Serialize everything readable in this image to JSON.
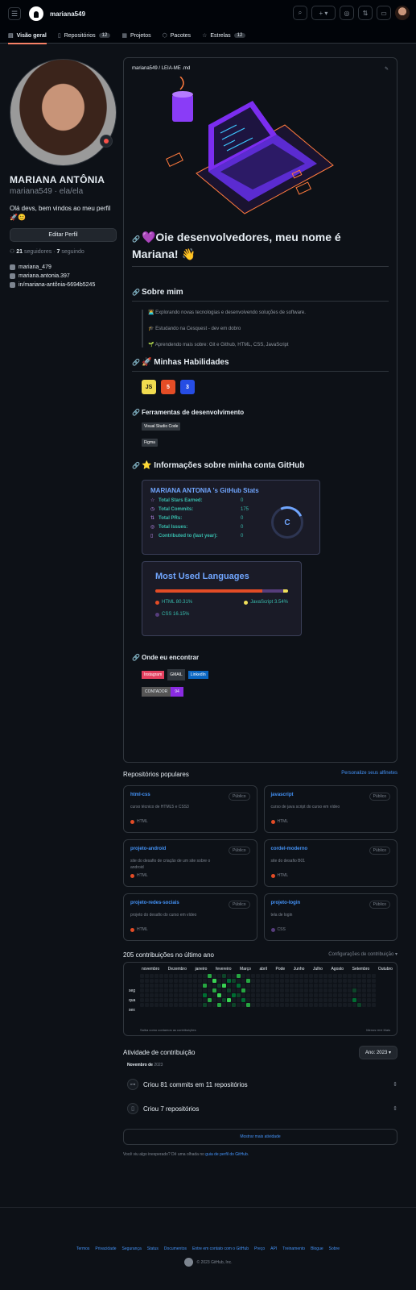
{
  "header": {
    "username": "mariana549",
    "menu_icon": "menu-icon",
    "plus_label": "+",
    "avatar_alt": "avatar"
  },
  "tabs": [
    {
      "label": "Visão geral",
      "active": true
    },
    {
      "label": "Repositórios",
      "count": "12"
    },
    {
      "label": "Projetos"
    },
    {
      "label": "Pacotes"
    },
    {
      "label": "Estrelas",
      "count": "12"
    }
  ],
  "profile": {
    "name": "MARIANA ANTÔNIA",
    "login": "mariana549",
    "pronouns": "· ela/ela",
    "bio": "Olá devs, bem vindos ao meu perfil 🚀😊",
    "edit_label": "Editar Perfil",
    "followers": "21",
    "followers_label": "seguidores",
    "following": "7",
    "following_label": "seguindo",
    "links": [
      "mariana_479",
      "mariana.antonia.397",
      "in/mariana-antônia-6694b5245"
    ]
  },
  "readme": {
    "path": "mariana549 / LEIA-ME .md",
    "title": "💜Oie desenvolvedores, meu nome é Mariana! 👋",
    "about_title": "Sobre mim",
    "about": [
      "👩‍💻 Explorando novas tecnologias e desenvolvendo soluções de software.",
      "🎓 Estudando na Cesquest - dev em dobro",
      "🌱 Aprendendo mais sobre: Git e Github, HTML, CSS, JavaScript"
    ],
    "skills_title": "🚀 Minhas Habilidades",
    "skills": [
      "JS",
      "5",
      "3"
    ],
    "tools_title": "Ferramentas de desenvolvimento",
    "tools": [
      "Visual Studio Code",
      "Figma"
    ],
    "stats_title": "⭐ Informações sobre minha conta GitHub",
    "stats_card": {
      "title": "MARIANA ANTONIA 's GitHub Stats",
      "rows": [
        {
          "label": "Total Stars Earned:",
          "value": "0"
        },
        {
          "label": "Total Commits:",
          "value": "175"
        },
        {
          "label": "Total PRs:",
          "value": "0"
        },
        {
          "label": "Total Issues:",
          "value": "0"
        },
        {
          "label": "Contributed to (last year):",
          "value": "0"
        }
      ],
      "grade": "C"
    },
    "langs_card": {
      "title": "Most Used Languages",
      "items": [
        {
          "name": "HTML 80.31%",
          "pct": 80.31,
          "color": "#e34c26"
        },
        {
          "name": "JavaScript 3.54%",
          "pct": 3.54,
          "color": "#f1e05a"
        },
        {
          "name": "CSS 16.15%",
          "pct": 16.15,
          "color": "#563d7c"
        }
      ]
    },
    "find_title": "Onde eu encontrar",
    "socials": [
      "Instagram",
      "GMAIL",
      "LinkedIn"
    ],
    "counter_label": "CONTADOR",
    "counter_value": "94"
  },
  "popular": {
    "title": "Repositórios populares",
    "customize": "Personalize seus alfinetes",
    "repos": [
      {
        "name": "html-css",
        "badge": "Público",
        "desc": "curso técnico de HTML5 e CSS3",
        "lang": "HTML",
        "color": "#e34c26"
      },
      {
        "name": "javascript",
        "badge": "Público",
        "desc": "curso de java script do curso em vídeo",
        "lang": "HTML",
        "color": "#e34c26"
      },
      {
        "name": "projeto-android",
        "badge": "Público",
        "desc": "site do desafio de criação de um site sobre o android",
        "lang": "HTML",
        "color": "#e34c26"
      },
      {
        "name": "cordel-moderno",
        "badge": "Público",
        "desc": "site do desafio B01",
        "lang": "HTML",
        "color": "#e34c26"
      },
      {
        "name": "projeto-redes-sociais",
        "badge": "Público",
        "desc": "projeto do desafio do curso em vídeo",
        "lang": "HTML",
        "color": "#e34c26"
      },
      {
        "name": "projeto-login",
        "badge": "Público",
        "desc": "tela de login",
        "lang": "CSS",
        "color": "#563d7c"
      }
    ]
  },
  "contrib": {
    "title": "205 contribuições no último ano",
    "settings": "Configurações de contribuição ▾",
    "months": [
      "novembro",
      "Dezembro",
      "janeiro",
      "fevereiro",
      "Março",
      "abril",
      "Pode",
      "Junho",
      "Julho",
      "Agosto",
      "Setembro",
      "Outubro"
    ],
    "days": [
      "seg",
      "qua",
      "sex"
    ],
    "learn": "Saiba como contamos as contribuições",
    "less": "Menos",
    "more": "Mais"
  },
  "activity": {
    "title": "Atividade de contribuição",
    "year": "Ano: 2023",
    "month": "Novembro de",
    "month_year": "2023",
    "items": [
      "Criou 81 commits em 11 repositórios",
      "Criou 7 repositórios"
    ],
    "more": "Mostrar mais atividade",
    "tip_a": "Você viu algo inesperado? Dê uma olhada no",
    "tip_link": "guia de perfil do GitHub"
  },
  "footer": {
    "links": [
      "Termos",
      "Privacidade",
      "Segurança",
      "Status",
      "Documentos",
      "Entre em contato com o GitHub",
      "Preço",
      "API",
      "Treinamento",
      "Blogue",
      "Sobre"
    ],
    "copy": "© 2023 GitHub, Inc."
  }
}
